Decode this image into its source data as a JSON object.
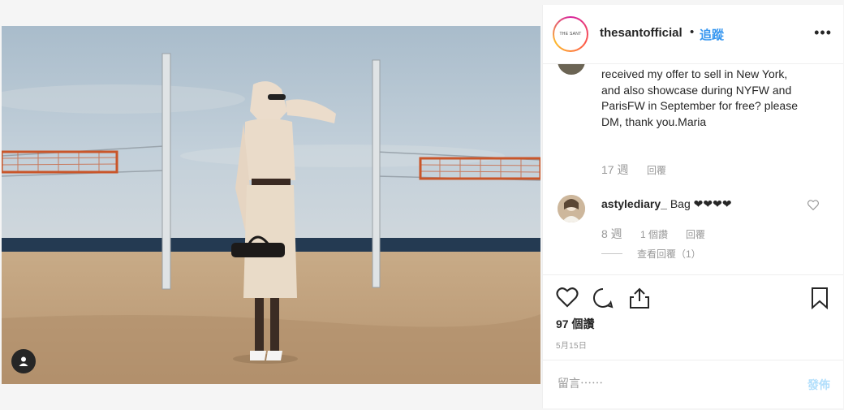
{
  "post": {
    "username": "thesantofficial",
    "separator": "•",
    "follow_label": "追蹤",
    "more_label": "•••",
    "avatar_text": "THE SANT"
  },
  "comments": [
    {
      "text": "received my offer to sell in New York, and also showcase during NYFW and ParisFW in September for free? please DM, thank you.Maria",
      "time": "17 週",
      "reply_label": "回覆"
    },
    {
      "username": "astylediary_",
      "text": "Bag ❤❤❤❤",
      "time": "8 週",
      "likes": "1 個讚",
      "reply_label": "回覆",
      "view_replies": "查看回覆（1）"
    }
  ],
  "engagement": {
    "likes": "97 個讚",
    "date": "5月15日"
  },
  "composer": {
    "placeholder": "留言⋯⋯",
    "post_label": "發佈"
  },
  "icons": [
    "user-tag-icon",
    "more-icon",
    "heart-icon",
    "comment-icon",
    "share-icon",
    "bookmark-icon"
  ]
}
